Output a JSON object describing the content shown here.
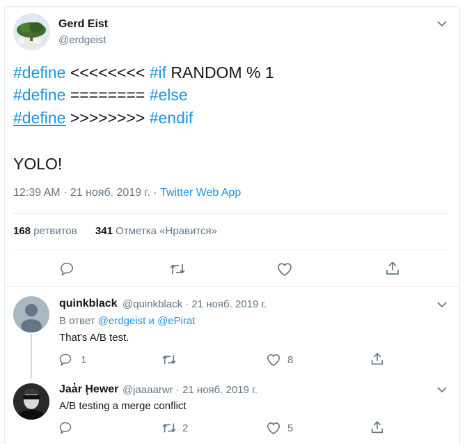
{
  "main_tweet": {
    "author_name": "Gerd Eist",
    "author_handle": "@erdgeist",
    "lines": [
      {
        "kw1": "#define",
        "mid": " <<<<<<<< ",
        "kw2": "#if",
        "rest": " RANDOM % 1"
      },
      {
        "kw1": "#define",
        "mid": " ======== ",
        "kw2": "#else",
        "rest": ""
      },
      {
        "kw1": "#define",
        "mid": " >>>>>>>> ",
        "kw2": "#endif",
        "rest": ""
      }
    ],
    "extra_text": "YOLO!",
    "timestamp": "12:39 AM · 21 нояб. 2019 г. · ",
    "source": "Twitter Web App",
    "retweets_count": "168",
    "retweets_label": "ретвитов",
    "likes_count": "341",
    "likes_label": "Отметка «Нравится»"
  },
  "replies": [
    {
      "author_name": "quinkblack",
      "author_handle": "@quinkblack · 21 нояб. 2019 г.",
      "reply_prefix": "В ответ ",
      "reply_handle1": "@erdgeist",
      "reply_joiner": " и ",
      "reply_handle2": "@ePirat",
      "text": "That's A/B test.",
      "reply_count": "1",
      "retweet_count": "",
      "like_count": "8"
    },
    {
      "author_name": "Jaa̓r Ḩewer",
      "author_handle": "@jaaaarwr · 21 нояб. 2019 г.",
      "text": "A/B testing a merge conflict",
      "reply_count": "",
      "retweet_count": "2",
      "like_count": "5"
    }
  ],
  "icons": {
    "reply": "reply-icon",
    "retweet": "retweet-icon",
    "like": "heart-icon",
    "share": "share-icon",
    "more": "chevron-down-icon"
  },
  "colors": {
    "link": "#1b95e0",
    "secondary_text": "#657786",
    "divider": "#e6ecf0"
  }
}
